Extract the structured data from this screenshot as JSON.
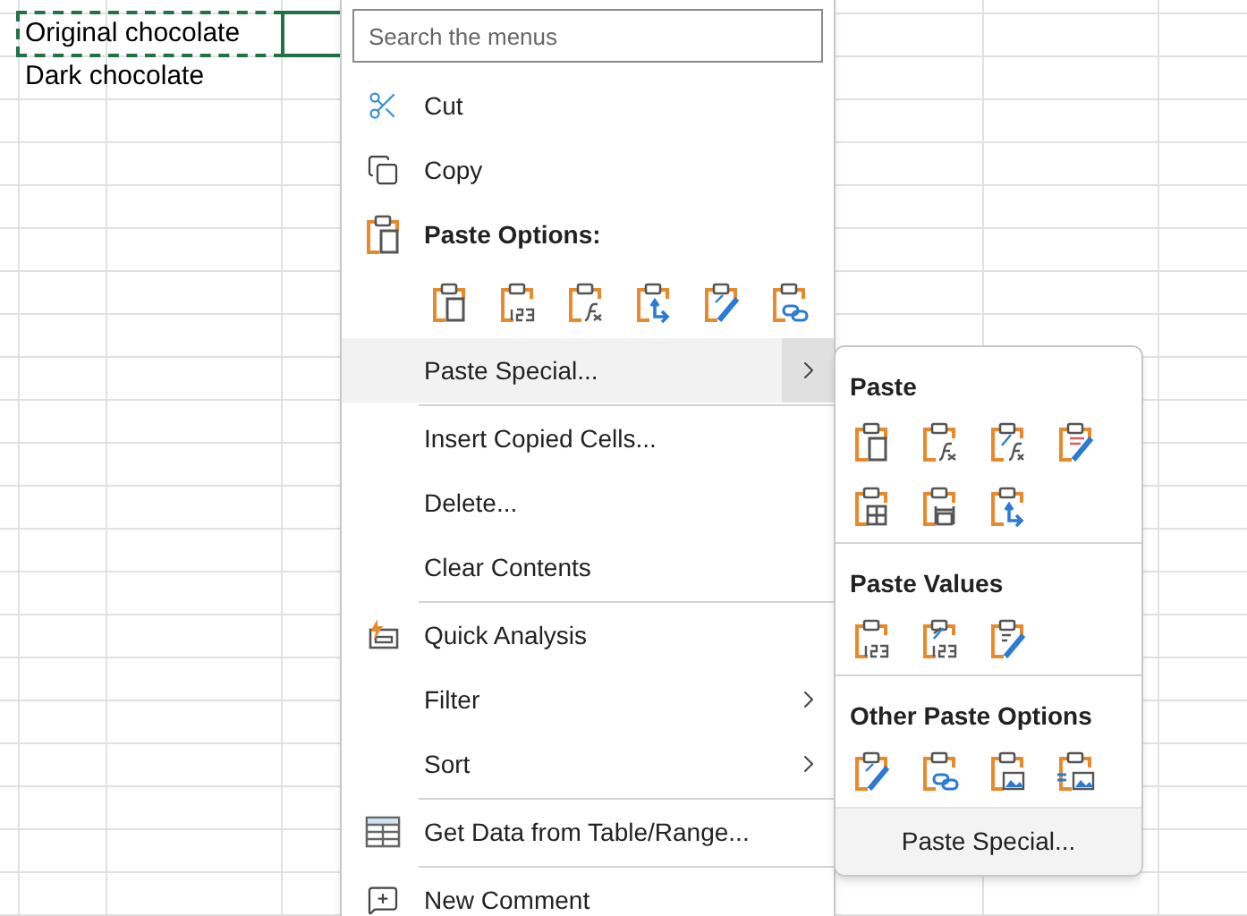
{
  "sheet": {
    "rows": [
      {
        "cells": [
          {
            "text": "Original chocolate",
            "copied": true,
            "selected": false
          },
          {
            "copied": false,
            "selected": true
          }
        ]
      },
      {
        "cells": [
          {
            "text": "Dark chocolate",
            "copied": false,
            "selected": false
          }
        ]
      }
    ]
  },
  "context_menu": {
    "search": {
      "placeholder": "Search the menus"
    },
    "items": [
      {
        "kind": "cut",
        "label": "Cut",
        "submenu": false,
        "selected": false
      },
      {
        "kind": "copy",
        "label": "Copy",
        "submenu": false,
        "selected": false
      },
      {
        "kind": "paste_header",
        "label": "Paste Options:"
      },
      {
        "kind": "icon_row",
        "icons": [
          {
            "kind": "all"
          },
          {
            "kind": "values"
          },
          {
            "kind": "formulas"
          },
          {
            "kind": "transpose"
          },
          {
            "kind": "formatting"
          },
          {
            "kind": "link"
          }
        ]
      },
      {
        "kind": "plain",
        "label": "Paste Special...",
        "submenu": true,
        "selected": true
      },
      {
        "kind": "separator"
      },
      {
        "kind": "plain",
        "label": "Insert Copied Cells...",
        "submenu": false,
        "selected": false
      },
      {
        "kind": "plain",
        "label": "Delete...",
        "submenu": false,
        "selected": false
      },
      {
        "kind": "plain",
        "label": "Clear Contents",
        "submenu": false,
        "selected": false
      },
      {
        "kind": "separator"
      },
      {
        "kind": "quick_analysis",
        "label": "Quick Analysis",
        "submenu": false,
        "selected": false
      },
      {
        "kind": "plain",
        "label": "Filter",
        "submenu": true,
        "selected": false
      },
      {
        "kind": "plain",
        "label": "Sort",
        "submenu": true,
        "selected": false
      },
      {
        "kind": "separator"
      },
      {
        "kind": "get_data",
        "label": "Get Data from Table/Range...",
        "submenu": false,
        "selected": false
      },
      {
        "kind": "separator"
      },
      {
        "kind": "new_comment",
        "label": "New Comment",
        "submenu": false,
        "selected": false
      }
    ]
  },
  "paste_special_submenu": {
    "sections": [
      {
        "title": "Paste",
        "icons": [
          {
            "kind": "all"
          },
          {
            "kind": "formulas"
          },
          {
            "kind": "percent_formula"
          },
          {
            "kind": "formatting_keep"
          },
          {
            "kind": "borders"
          },
          {
            "kind": "column_widths"
          },
          {
            "kind": "transpose"
          }
        ]
      },
      {
        "title": "Paste Values",
        "icons": [
          {
            "kind": "values"
          },
          {
            "kind": "percent_values"
          },
          {
            "kind": "values_formatting"
          }
        ]
      },
      {
        "title": "Other Paste Options",
        "icons": [
          {
            "kind": "formatting"
          },
          {
            "kind": "link"
          },
          {
            "kind": "picture"
          },
          {
            "kind": "linked_picture"
          }
        ]
      }
    ],
    "footer": {
      "label": "Paste Special..."
    }
  }
}
